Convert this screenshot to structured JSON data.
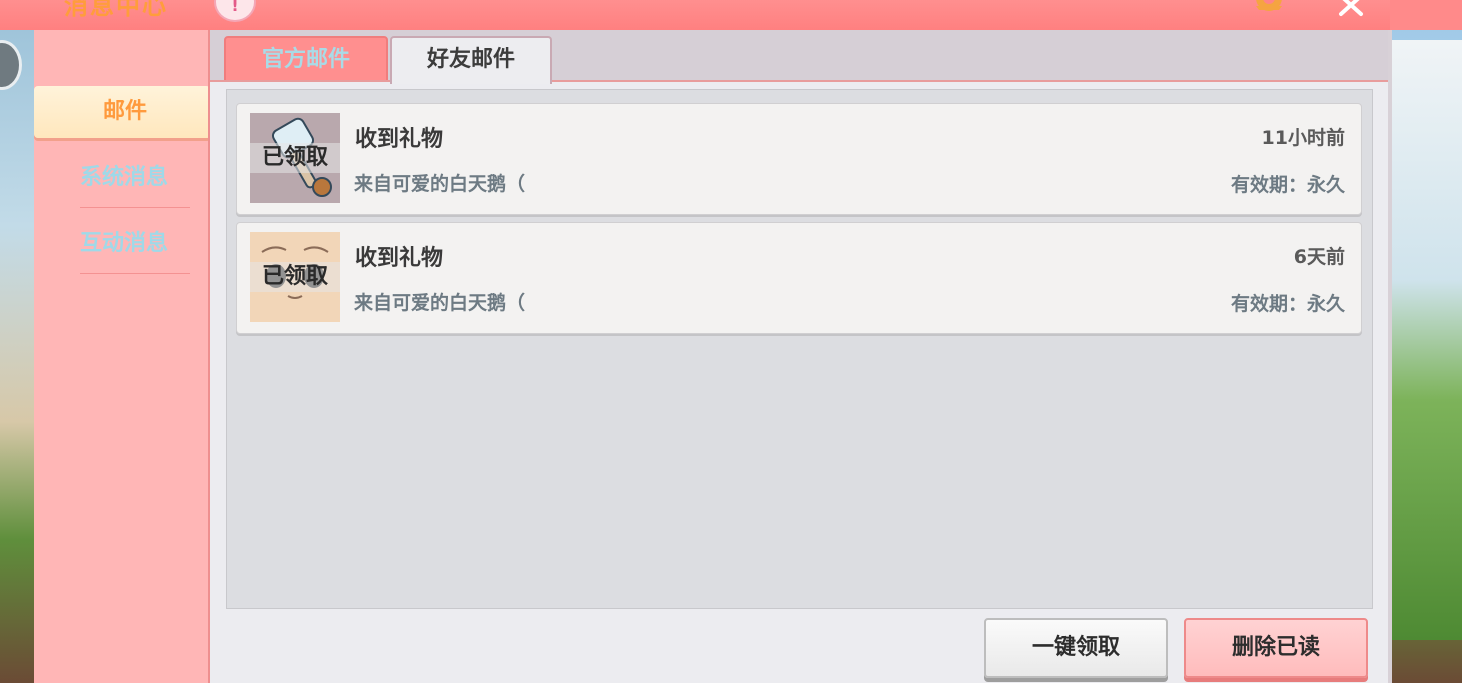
{
  "window": {
    "title": "消息中心",
    "badge": "!"
  },
  "sidebar": {
    "items": [
      {
        "label": "邮件"
      },
      {
        "label": "系统消息"
      },
      {
        "label": "互动消息"
      }
    ]
  },
  "tabs": [
    {
      "label": "官方邮件"
    },
    {
      "label": "好友邮件"
    }
  ],
  "mails": [
    {
      "title": "收到礼物",
      "from": "来自可爱的白天鹅（",
      "time": "11小时前",
      "expiry": "有效期：永久",
      "status": "已领取",
      "icon": "hammer-icon"
    },
    {
      "title": "收到礼物",
      "from": "来自可爱的白天鹅（",
      "time": "6天前",
      "expiry": "有效期：永久",
      "status": "已领取",
      "icon": "face-icon"
    }
  ],
  "actions": {
    "claim_all": "一键领取",
    "delete_read": "删除已读"
  },
  "colors": {
    "title_bar": "#ff8585",
    "sidebar": "#ffb6b6",
    "active_text": "#ff9a3d",
    "inactive_text": "#9fd9e8"
  }
}
